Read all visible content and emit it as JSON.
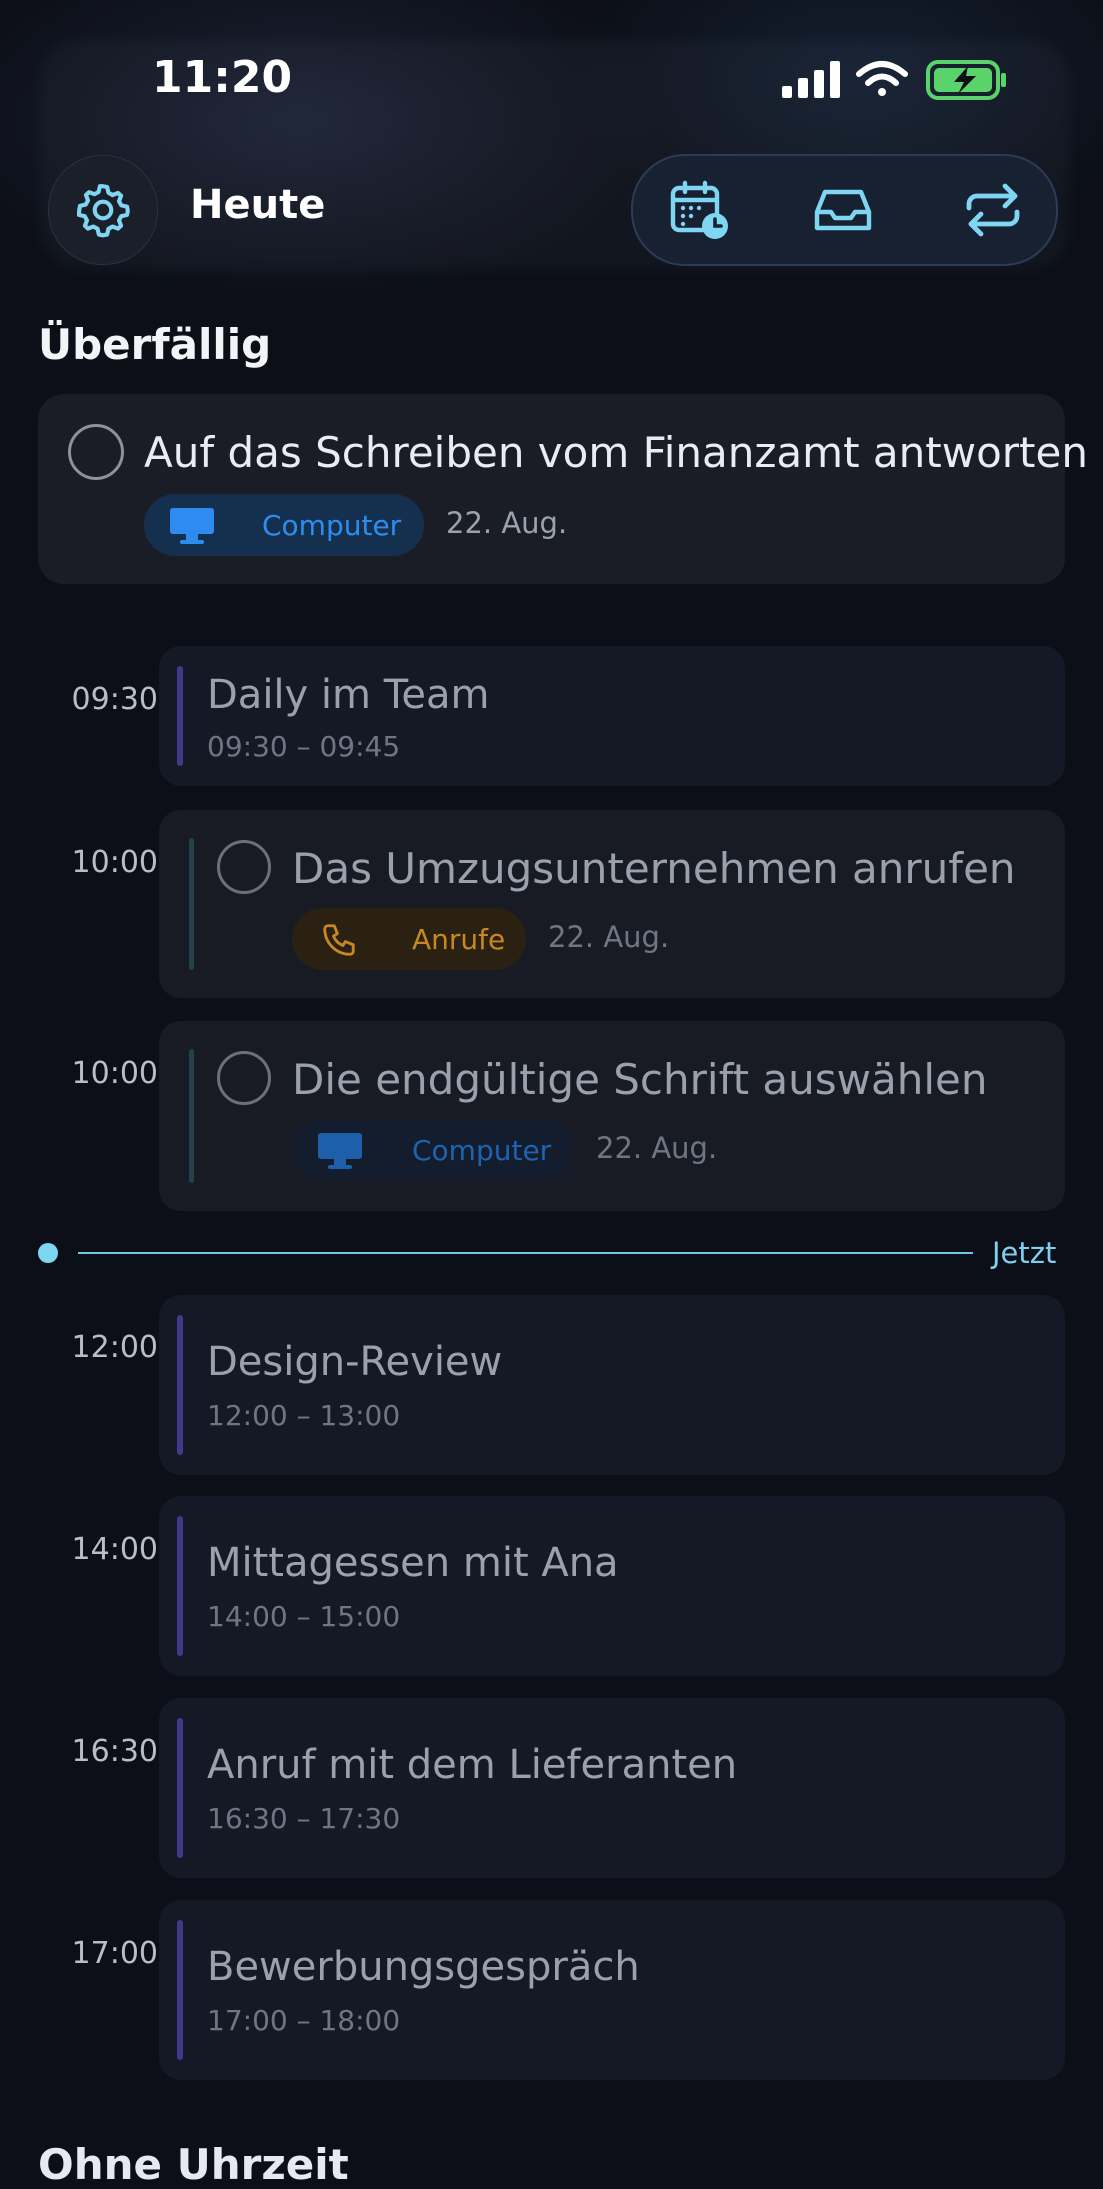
{
  "status_bar": {
    "time": "11:20"
  },
  "header": {
    "title": "Heute",
    "settings_icon": "gear-icon",
    "actions": [
      "calendar-clock-icon",
      "inbox-tray-icon",
      "repeat-arrows-icon"
    ]
  },
  "overdue": {
    "heading": "Überfällig",
    "task": {
      "title": "Auf das Schreiben vom Finanzamt antworten",
      "tag": "Computer",
      "date": "22. Aug."
    }
  },
  "timeline": {
    "events": [
      {
        "time": "09:30",
        "title": "Daily im Team",
        "range": "09:30 – 09:45"
      },
      {
        "time": "12:00",
        "title": "Design-Review",
        "range": "12:00 – 13:00"
      },
      {
        "time": "14:00",
        "title": "Mittagessen mit Ana",
        "range": "14:00 – 15:00"
      },
      {
        "time": "16:30",
        "title": "Anruf mit dem Lieferanten",
        "range": "16:30 – 17:30"
      },
      {
        "time": "17:00",
        "title": "Bewerbungsgespräch",
        "range": "17:00 – 18:00"
      }
    ],
    "tasks": [
      {
        "time": "10:00",
        "title": "Das Umzugsunternehmen anrufen",
        "tag": "Anrufe",
        "date": "22. Aug."
      },
      {
        "time": "10:00",
        "title": "Die endgültige Schrift auswählen",
        "tag": "Computer",
        "date": "22. Aug."
      }
    ],
    "now_label": "Jetzt"
  },
  "colors": {
    "accent": "#7fd6f3",
    "computer_tag": "#2e8cf0",
    "calls_tag": "#c98722",
    "event_bar": "#3e3b8a"
  },
  "bottom_heading": "Ohne Uhrzeit"
}
